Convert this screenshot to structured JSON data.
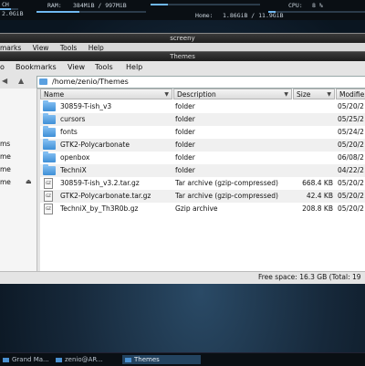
{
  "topbar": {
    "left_label": "CH",
    "left_sub": "2.0GiB",
    "ram_label": "RAM:",
    "ram_value": "384MiB / 997MiB",
    "ram_fraction": 0.39,
    "home_label": "Home:",
    "home_value": "1.86GiB / 11.9GiB",
    "home_fraction": 0.16,
    "cpu_label": "CPU:",
    "cpu_value": "8 %",
    "cpu_fraction": 0.08
  },
  "back_window": {
    "title": "screeny",
    "menu": [
      "marks",
      "View",
      "Tools",
      "Help"
    ]
  },
  "window": {
    "title": "Themes",
    "menu": [
      "o",
      "Bookmarks",
      "View",
      "Tools",
      "Help"
    ],
    "path": "/home/zenio/Themes"
  },
  "sidebar": {
    "items": [
      "ms",
      "me",
      "me",
      "me"
    ]
  },
  "columns": {
    "name": "Name",
    "description": "Description",
    "size": "Size",
    "modified": "Modifie"
  },
  "files": [
    {
      "name": "30859-T-ish_v3",
      "description": "folder",
      "size": "",
      "modified": "05/20/2",
      "type": "folder"
    },
    {
      "name": "cursors",
      "description": "folder",
      "size": "",
      "modified": "05/25/2",
      "type": "folder"
    },
    {
      "name": "fonts",
      "description": "folder",
      "size": "",
      "modified": "05/24/2",
      "type": "folder"
    },
    {
      "name": "GTK2-Polycarbonate",
      "description": "folder",
      "size": "",
      "modified": "05/20/2",
      "type": "folder"
    },
    {
      "name": "openbox",
      "description": "folder",
      "size": "",
      "modified": "06/08/2",
      "type": "folder"
    },
    {
      "name": "TechniX",
      "description": "folder",
      "size": "",
      "modified": "04/22/2",
      "type": "folder"
    },
    {
      "name": "30859-T-ish_v3.2.tar.gz",
      "description": "Tar archive (gzip-compressed)",
      "size": "668.4 KB",
      "modified": "05/20/2",
      "type": "archive"
    },
    {
      "name": "GTK2-Polycarbonate.tar.gz",
      "description": "Tar archive (gzip-compressed)",
      "size": "42.4 KB",
      "modified": "05/20/2",
      "type": "archive"
    },
    {
      "name": "TechniX_by_Th3R0b.gz",
      "description": "Gzip archive",
      "size": "208.8 KB",
      "modified": "05/20/2",
      "type": "archive"
    }
  ],
  "status": {
    "free_space": "Free space: 16.3 GB (Total: 19"
  },
  "taskbar": {
    "items": [
      {
        "label": "Grand Ma...",
        "active": false
      },
      {
        "label": "zenio@AR...",
        "active": false
      },
      {
        "label": "Themes",
        "active": true
      }
    ]
  },
  "colors": {
    "folder": "#3e8fd6",
    "taskbar_active": "#23435f",
    "meter": "#6fb7f0"
  }
}
